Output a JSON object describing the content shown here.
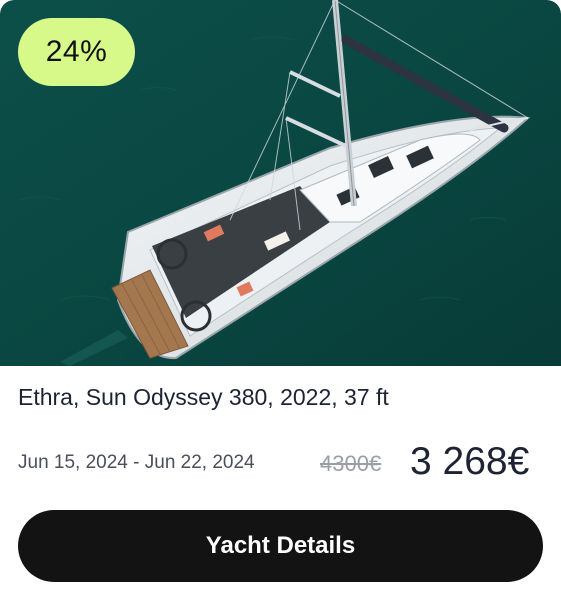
{
  "badge": {
    "discount": "24%"
  },
  "listing": {
    "title": "Ethra, Sun Odyssey 380, 2022, 37 ft",
    "dates": "Jun 15, 2024 - Jun 22, 2024",
    "old_price": "4300€",
    "new_price": "3 268€"
  },
  "actions": {
    "details_label": "Yacht Details"
  },
  "colors": {
    "badge_bg": "#d6f98a",
    "button_bg": "#131313",
    "water": "#0b4a45"
  }
}
